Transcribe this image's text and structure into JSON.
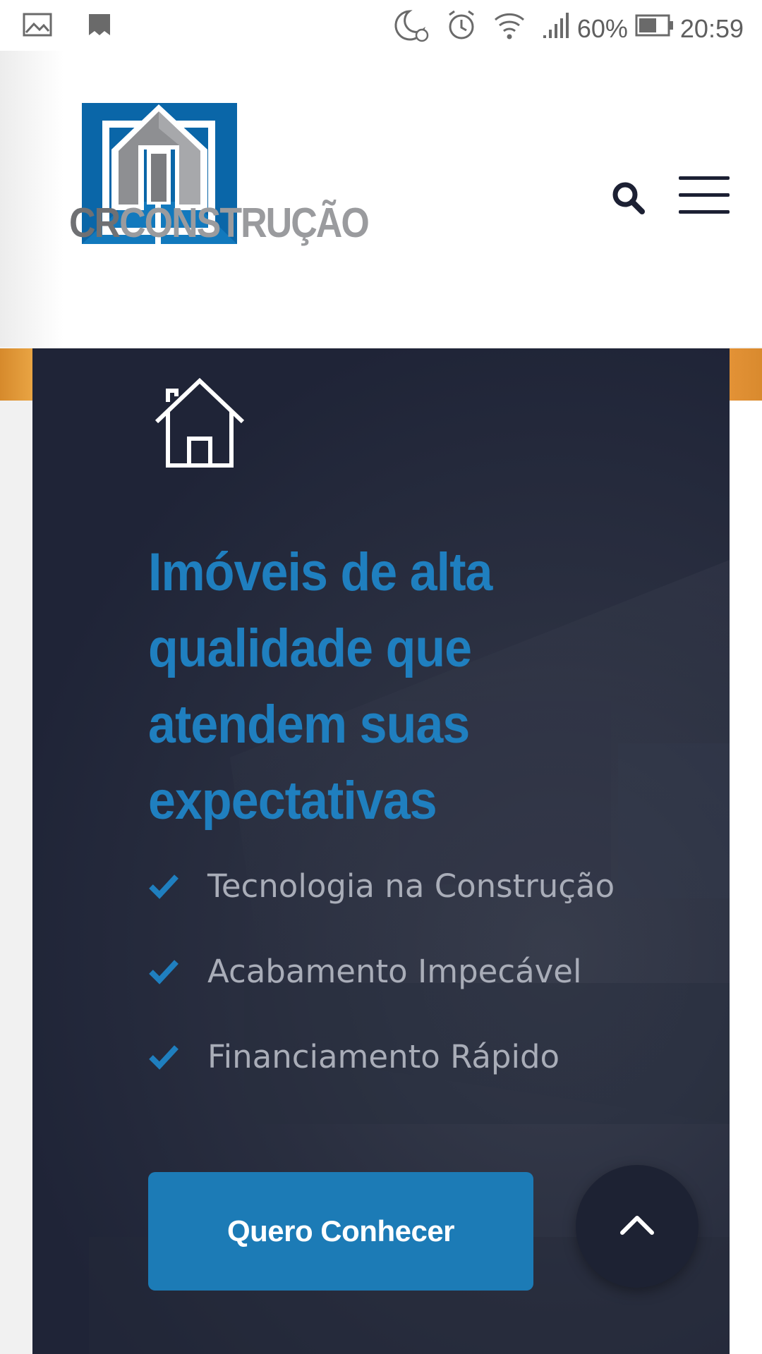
{
  "status_bar": {
    "battery_percent": "60%",
    "time": "20:59",
    "icons": [
      "image-icon",
      "bookmark-icon",
      "moon-alarm-icon",
      "alarm-icon",
      "wifi-icon",
      "signal-icon",
      "battery-icon"
    ]
  },
  "header": {
    "logo": {
      "text_cr": "CR",
      "text_rest": "CONSTRUÇÃO"
    },
    "search_icon": "search-icon",
    "menu_icon": "hamburger-menu-icon"
  },
  "hero": {
    "icon": "house-icon",
    "title": "Imóveis de alta qualidade que atendem suas expectativas",
    "features": [
      "Tecnologia na Construção",
      "Acabamento Impecável",
      "Financiamento Rápido"
    ],
    "cta_label": "Quero Conhecer"
  },
  "scroll_top_icon": "chevron-up-icon",
  "colors": {
    "accent_blue": "#1f7fbf",
    "button_blue": "#1c7bb6",
    "hero_bg": "#1f2437",
    "orange_strip": "#e39236",
    "logo_gray_dark": "#6f7073",
    "logo_gray_light": "#9a9b9e"
  }
}
